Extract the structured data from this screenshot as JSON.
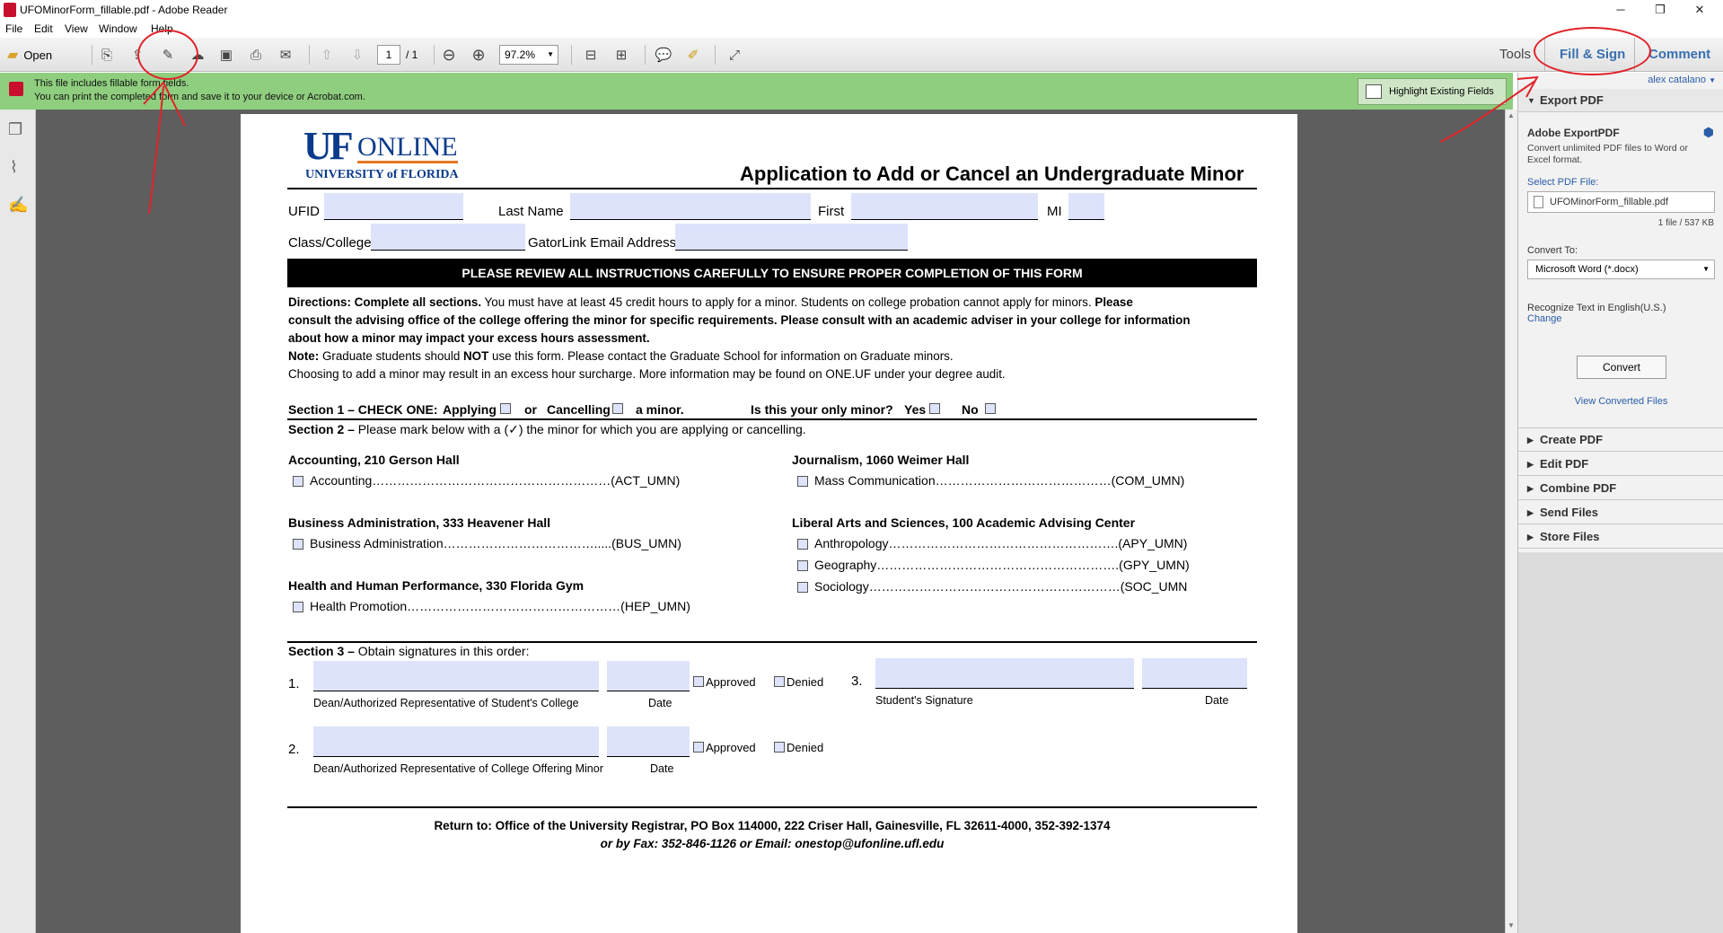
{
  "window": {
    "title": "UFOMinorForm_fillable.pdf - Adobe Reader",
    "user": "alex catalano"
  },
  "menu": [
    "File",
    "Edit",
    "View",
    "Window",
    "Help"
  ],
  "toolbar": {
    "open": "Open",
    "page_current": "1",
    "page_total": "/ 1",
    "zoom": "97.2%",
    "tab_tools": "Tools",
    "tab_fill": "Fill & Sign",
    "tab_comment": "Comment"
  },
  "notice": {
    "line1": "This file includes fillable form fields.",
    "line2": "You can print the completed form and save it to your device or Acrobat.com.",
    "highlight_btn": "Highlight Existing Fields"
  },
  "panel": {
    "export_title": "Export PDF",
    "product": "Adobe ExportPDF",
    "desc": "Convert unlimited PDF files to Word or Excel format.",
    "select_label": "Select PDF File:",
    "file": "UFOMinorForm_fillable.pdf",
    "file_info": "1 file / 537 KB",
    "convert_to": "Convert To:",
    "format": "Microsoft Word (*.docx)",
    "recognize": "Recognize Text in English(U.S.)",
    "change": "Change",
    "convert_btn": "Convert",
    "view_converted": "View Converted Files",
    "sections": [
      "Create PDF",
      "Edit PDF",
      "Combine PDF",
      "Send Files",
      "Store Files"
    ]
  },
  "form": {
    "logo_uf": "UF",
    "logo_online": "ONLINE",
    "logo_univ": "UNIVERSITY of FLORIDA",
    "title": "Application to Add or Cancel an Undergraduate Minor",
    "ufid": "UFID",
    "last": "Last Name",
    "first": "First",
    "mi": "MI",
    "class": "Class/College",
    "email": "GatorLink Email Address",
    "banner": "PLEASE REVIEW ALL INSTRUCTIONS CAREFULLY TO ENSURE PROPER COMPLETION OF THIS FORM",
    "dir1a": "Directions: Complete all sections.",
    "dir1b": " You must have at least 45 credit hours to apply for a minor. Students on college probation cannot apply for minors. ",
    "dir1c": "Please",
    "dir2": "consult the advising office of the college offering the minor for specific requirements. Please consult with an academic adviser in your college for information",
    "dir3": "about how a minor may impact your excess hours assessment.",
    "note_a": "Note:",
    "note_b": " Graduate students should ",
    "note_c": "NOT",
    "note_d": " use this form. Please contact the Graduate School for information on Graduate minors.",
    "note2": "Choosing to add a minor may result in an excess hour surcharge. More information may be found on ONE.UF under your degree audit.",
    "s1": "Section 1 – CHECK ONE:",
    "applying": "Applying",
    "or": "or",
    "cancelling": "Cancelling",
    "aminor": "a minor.",
    "only": "Is this your only minor?",
    "yes": "Yes",
    "no": "No",
    "s2a": "Section 2 –",
    "s2b": " Please mark below with a (✓) the minor for which you are applying or cancelling.",
    "acc_h": "Accounting, 210 Gerson Hall",
    "acc": "Accounting…………………………………………………(ACT_UMN)",
    "bus_h": "Business Administration, 333 Heavener Hall",
    "bus": "Business Administration……………………………….....(BUS_UMN)",
    "hhp_h": "Health and Human Performance, 330 Florida Gym",
    "hhp": "Health Promotion……………………………………………(HEP_UMN)",
    "jou_h": "Journalism, 1060 Weimer Hall",
    "jou": "Mass Communication……………………………………(COM_UMN)",
    "las_h": "Liberal Arts and Sciences, 100 Academic Advising Center",
    "anth": "Anthropology……………………………………………….(APY_UMN)",
    "geo": "Geography………………………………………………….(GPY_UMN)",
    "soc": "Sociology……………………………………………………(SOC_UMN",
    "s3a": "Section 3 –",
    "s3b": " Obtain signatures in this order:",
    "n1": "1.",
    "n2": "2.",
    "n3": "3.",
    "approved": "Approved",
    "denied": "Denied",
    "dean1": "Dean/Authorized Representative of Student's College",
    "dean2": "Dean/Authorized Representative of College Offering Minor",
    "date": "Date",
    "student_sig": "Student's Signature",
    "ret1": "Return to: Office of the University Registrar, PO Box 114000, 222 Criser Hall, Gainesville, FL 32611-4000, 352-392-1374",
    "ret2": "or by Fax: 352-846-1126 or Email: onestop@ufonline.ufl.edu"
  }
}
